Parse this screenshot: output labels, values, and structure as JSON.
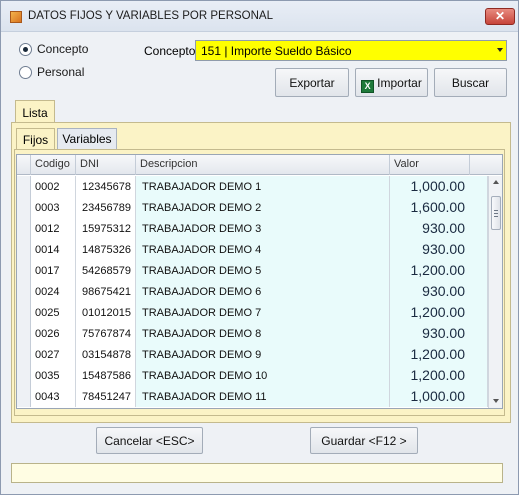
{
  "window": {
    "title": "DATOS FIJOS Y VARIABLES POR PERSONAL",
    "close_label": "✕"
  },
  "mode": {
    "options": [
      {
        "label": "Concepto",
        "selected": true
      },
      {
        "label": "Personal",
        "selected": false
      }
    ]
  },
  "concept": {
    "label": "Concepto",
    "value": "151 | Importe Sueldo Básico",
    "highlight_color": "#ffff00"
  },
  "actions": {
    "export_label": "Exportar",
    "import_label": "Importar",
    "import_icon": "excel-icon",
    "search_label": "Buscar"
  },
  "tabs": {
    "outer": "Lista",
    "inner": [
      "Fijos",
      "Variables"
    ]
  },
  "table": {
    "columns": [
      "Codigo",
      "DNI",
      "Descripcion",
      "Valor"
    ],
    "rows": [
      {
        "codigo": "0002",
        "dni": "12345678",
        "descripcion": "TRABAJADOR DEMO 1",
        "valor": "1,000.00"
      },
      {
        "codigo": "0003",
        "dni": "23456789",
        "descripcion": "TRABAJADOR DEMO 2",
        "valor": "1,600.00"
      },
      {
        "codigo": "0012",
        "dni": "15975312",
        "descripcion": "TRABAJADOR DEMO 3",
        "valor": "930.00"
      },
      {
        "codigo": "0014",
        "dni": "14875326",
        "descripcion": "TRABAJADOR DEMO 4",
        "valor": "930.00"
      },
      {
        "codigo": "0017",
        "dni": "54268579",
        "descripcion": "TRABAJADOR DEMO 5",
        "valor": "1,200.00"
      },
      {
        "codigo": "0024",
        "dni": "98675421",
        "descripcion": "TRABAJADOR DEMO 6",
        "valor": "930.00"
      },
      {
        "codigo": "0025",
        "dni": "01012015",
        "descripcion": "TRABAJADOR DEMO 7",
        "valor": "1,200.00"
      },
      {
        "codigo": "0026",
        "dni": "75767874",
        "descripcion": "TRABAJADOR DEMO 8",
        "valor": "930.00"
      },
      {
        "codigo": "0027",
        "dni": "03154878",
        "descripcion": "TRABAJADOR DEMO 9",
        "valor": "1,200.00"
      },
      {
        "codigo": "0035",
        "dni": "15487586",
        "descripcion": "TRABAJADOR DEMO 10",
        "valor": "1,200.00"
      },
      {
        "codigo": "0043",
        "dni": "78451247",
        "descripcion": "TRABAJADOR DEMO 11",
        "valor": "1,000.00"
      }
    ]
  },
  "footer": {
    "cancel_label": "Cancelar <ESC>",
    "save_label": "Guardar <F12 >"
  }
}
